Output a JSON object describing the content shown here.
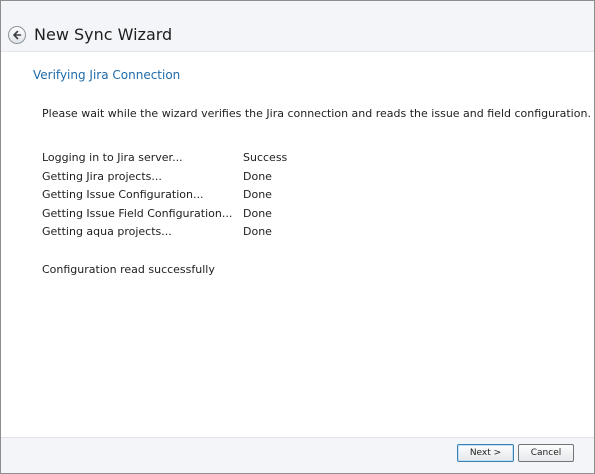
{
  "header": {
    "title": "New Sync Wizard"
  },
  "main": {
    "heading": "Verifying Jira Connection",
    "description": "Please wait while the wizard verifies the Jira connection and reads the issue and field configuration.",
    "steps": [
      {
        "label": "Logging in to Jira server...",
        "status": "Success"
      },
      {
        "label": "Getting Jira projects...",
        "status": "Done"
      },
      {
        "label": "Getting Issue Configuration...",
        "status": "Done"
      },
      {
        "label": "Getting Issue Field Configuration...",
        "status": "Done"
      },
      {
        "label": "Getting aqua projects...",
        "status": "Done"
      }
    ],
    "result": "Configuration read successfully"
  },
  "footer": {
    "next_label": "Next >",
    "cancel_label": "Cancel"
  },
  "colors": {
    "heading": "#1e6aa8",
    "header_bg": "#f3f5f8"
  }
}
